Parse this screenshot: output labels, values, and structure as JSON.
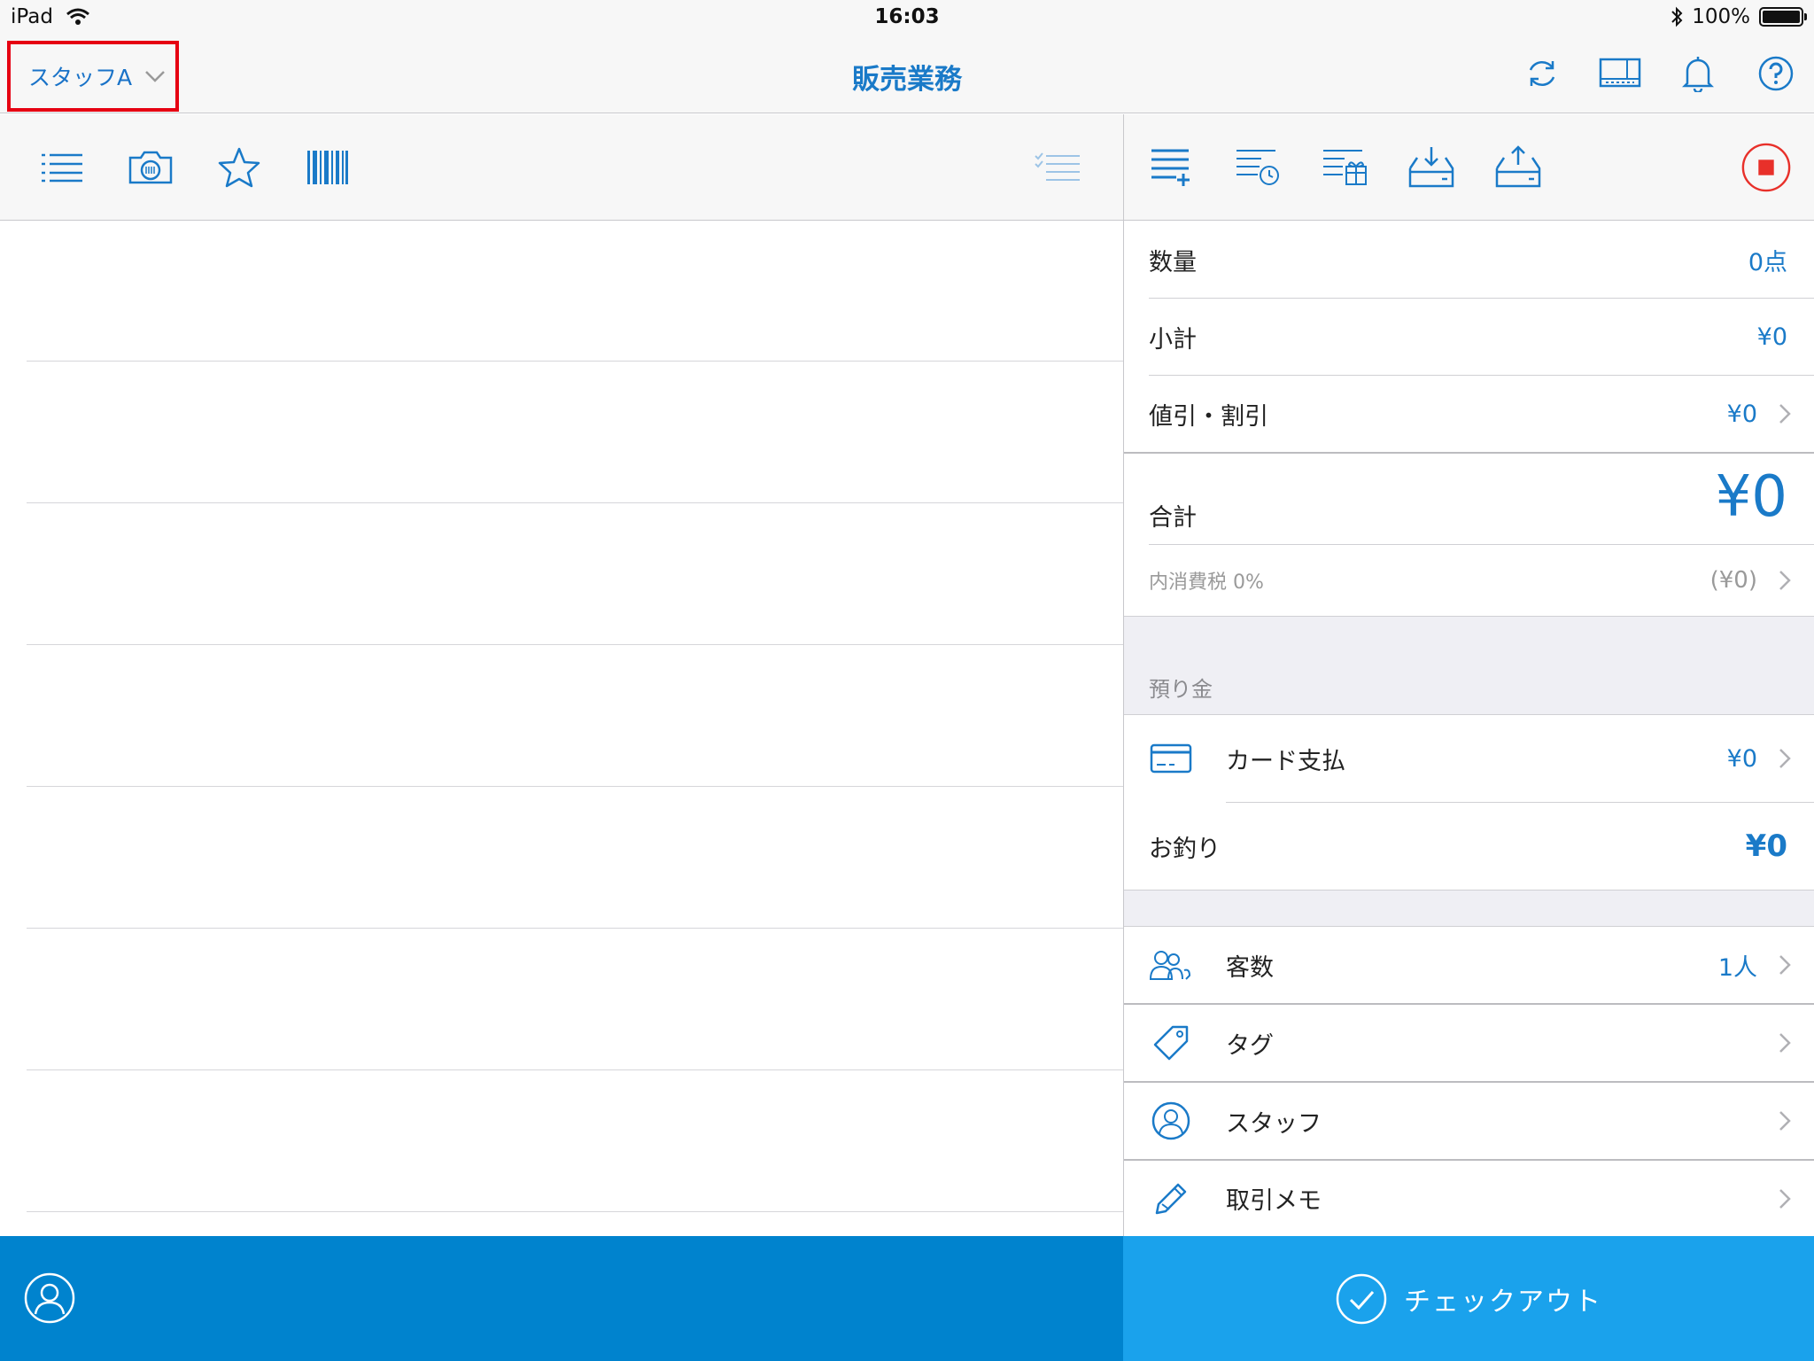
{
  "status_bar": {
    "device": "iPad",
    "time": "16:03",
    "battery": "100%"
  },
  "nav": {
    "staff_selector": "スタッフA",
    "title": "販売業務",
    "icons": [
      "sync-icon",
      "register-icon",
      "bell-icon",
      "help-icon"
    ]
  },
  "left_toolbar": {
    "icons": [
      "list-icon",
      "camera-icon",
      "star-icon",
      "barcode-icon",
      "checklist-icon"
    ]
  },
  "right_toolbar": {
    "icons": [
      "add-item-icon",
      "history-list-icon",
      "gift-list-icon",
      "tray-download-icon",
      "tray-upload-icon",
      "stop-icon"
    ]
  },
  "summary": {
    "quantity": {
      "label": "数量",
      "value": "0点"
    },
    "subtotal": {
      "label": "小計",
      "value": "¥0"
    },
    "discount": {
      "label": "値引・割引",
      "value": "¥0"
    },
    "total": {
      "label": "合計",
      "value": "¥0"
    },
    "tax": {
      "label": "内消費税 0%",
      "value": "(¥0)"
    },
    "deposit_header": "預り金",
    "card_payment": {
      "label": "カード支払",
      "value": "¥0"
    },
    "change": {
      "label": "お釣り",
      "value": "¥0"
    },
    "customers": {
      "label": "客数",
      "value": "1人"
    },
    "tag": {
      "label": "タグ"
    },
    "staff": {
      "label": "スタッフ"
    },
    "memo": {
      "label": "取引メモ"
    }
  },
  "bottom": {
    "checkout_label": "チェックアウト"
  },
  "colors": {
    "accent": "#1a7ac8",
    "bottom_left": "#0083ce",
    "checkout": "#1aa2ec",
    "highlight_box": "#e60012",
    "stop": "#e8302a"
  }
}
